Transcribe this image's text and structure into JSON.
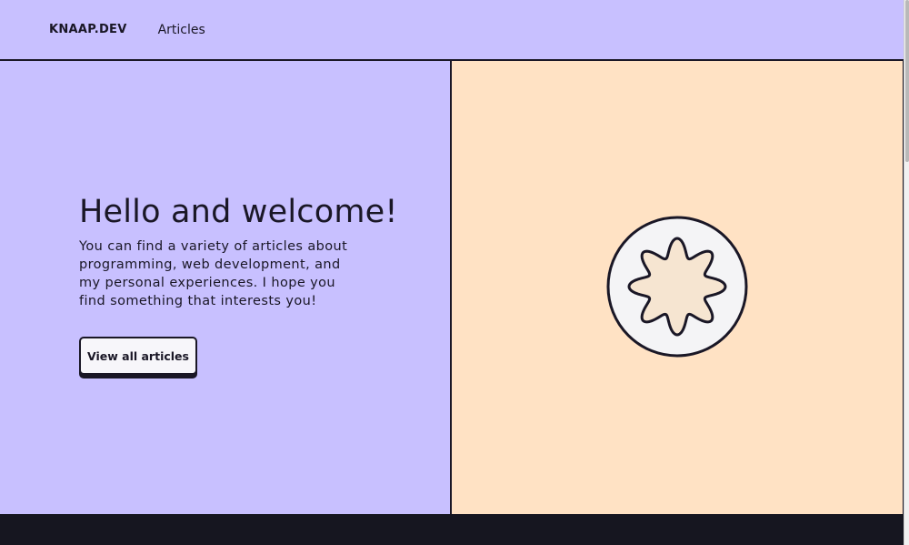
{
  "nav": {
    "brand": "KNAAP.DEV",
    "links": [
      {
        "label": "Articles"
      }
    ]
  },
  "hero": {
    "title": "Hello and welcome!",
    "description": "You can find a variety of articles about programming, web development, and my personal experiences. I hope you find something that interests you!",
    "cta_label": "View all articles"
  },
  "colors": {
    "lavender": "#c8c0ff",
    "peach": "#ffe2c4",
    "ink": "#1a1726",
    "footer": "#161620"
  },
  "icons": {
    "emblem": "flower-badge-icon"
  }
}
